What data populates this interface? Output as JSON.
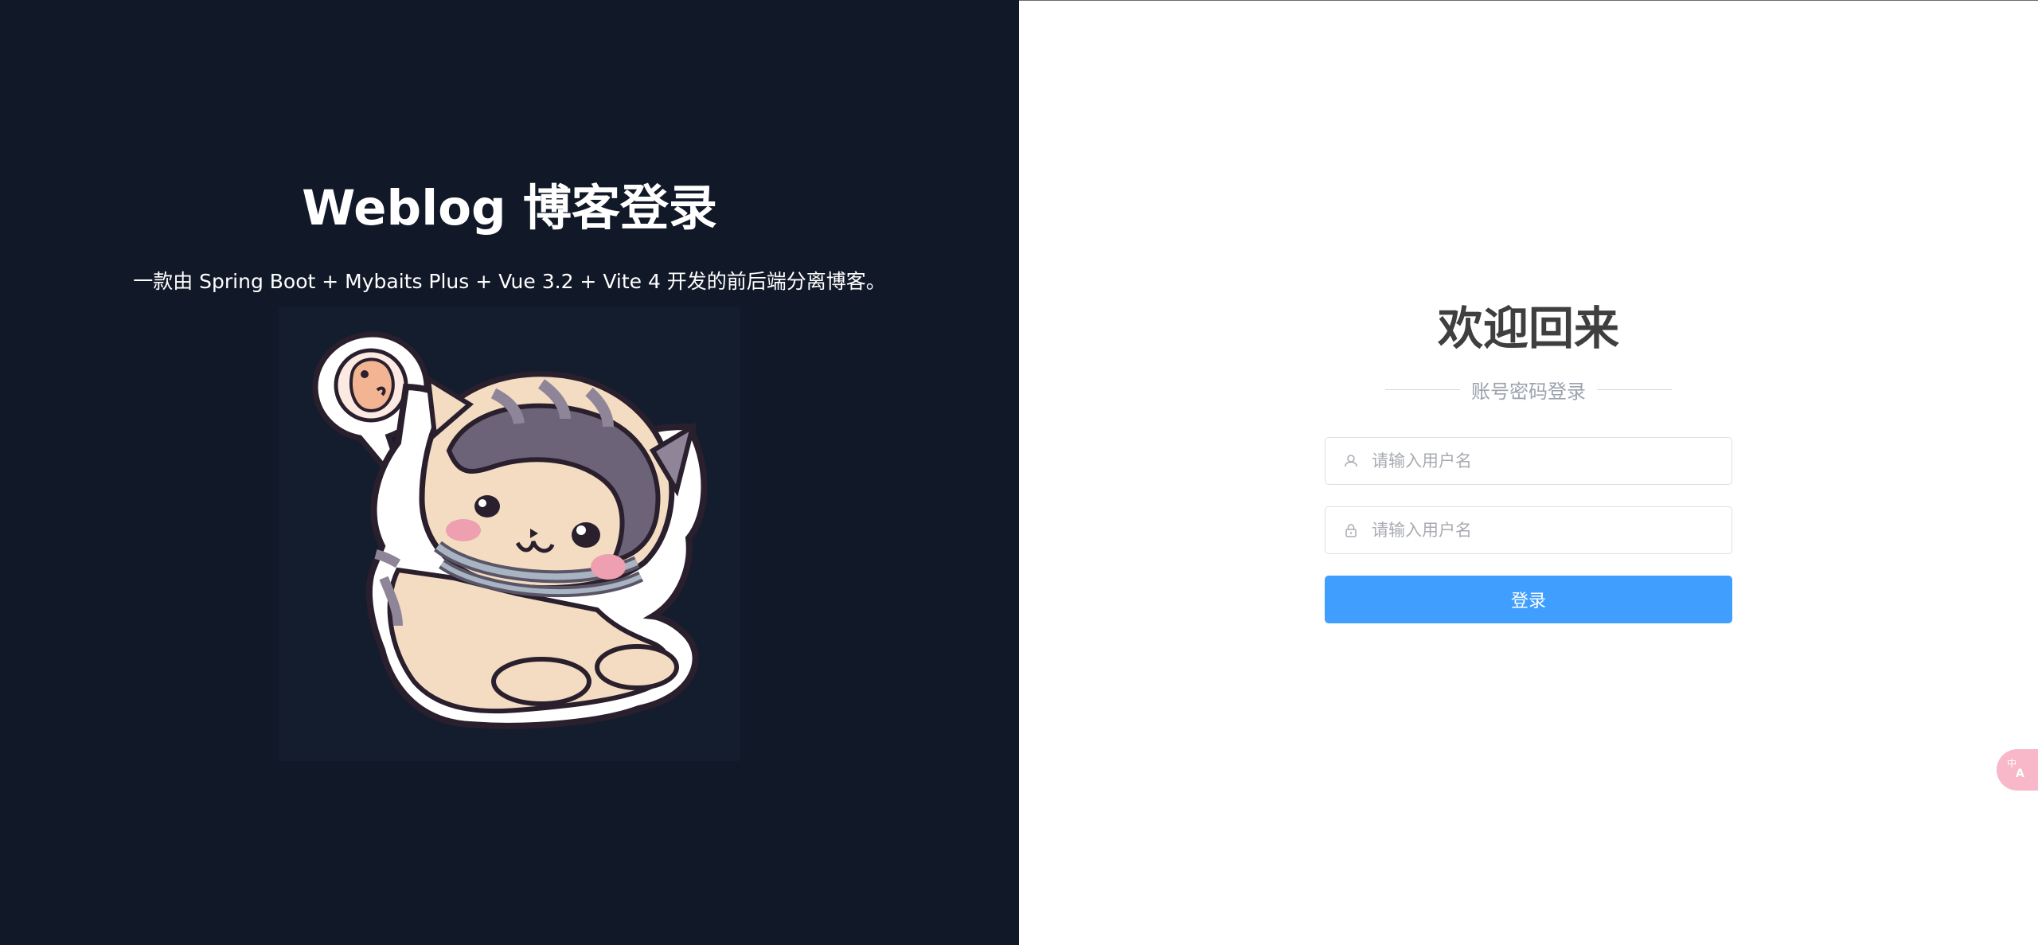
{
  "left_panel": {
    "title": "Weblog 博客登录",
    "subtitle": "一款由 Spring Boot + Mybaits Plus + Vue 3.2 + Vite 4 开发的前后端分离博客。",
    "illustration_icon": "astronaut-cat-illustration"
  },
  "login_form": {
    "heading": "欢迎回来",
    "divider_text": "账号密码登录",
    "username": {
      "value": "",
      "placeholder": "请输入用户名",
      "icon": "user-icon"
    },
    "password": {
      "value": "",
      "placeholder": "请输入用户名",
      "icon": "lock-icon"
    },
    "submit_label": "登录"
  },
  "floating": {
    "translate_icon": "translate-icon"
  },
  "colors": {
    "left_background": "#111827",
    "right_background": "#ffffff",
    "primary_button": "#409eff",
    "heading_text": "#3f3f3f",
    "muted_text": "#9ca3af",
    "translate_fab": "#f8b8c9"
  }
}
